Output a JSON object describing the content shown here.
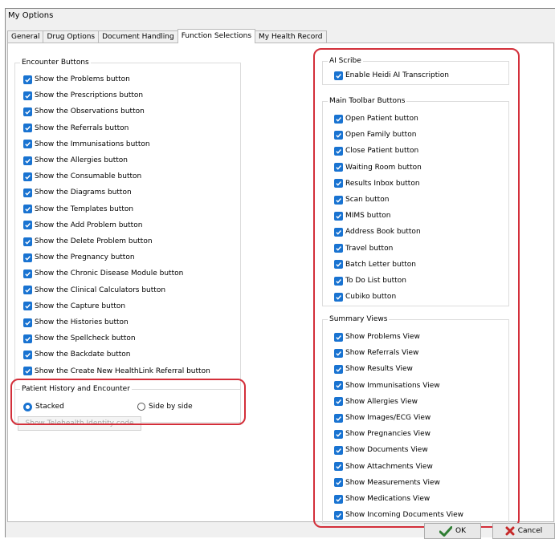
{
  "window": {
    "title": "My Options"
  },
  "tabs": [
    "General",
    "Drug Options",
    "Document Handling",
    "Function Selections",
    "My Health Record"
  ],
  "encounter": {
    "legend": "Encounter Buttons",
    "items": [
      "Show the Problems button",
      "Show the Prescriptions button",
      "Show the Observations button",
      "Show the Referrals button",
      "Show the Immunisations button",
      "Show the Allergies button",
      "Show the Consumable button",
      "Show the Diagrams button",
      "Show the Templates button",
      "Show the Add Problem button",
      "Show the Delete Problem button",
      "Show the Pregnancy button",
      "Show the Chronic Disease Module button",
      "Show the Clinical Calculators button",
      "Show the Capture button",
      "Show the Histories button",
      "Show the Spellcheck button",
      "Show the Backdate button",
      "Show the Create New HealthLink Referral button"
    ]
  },
  "history": {
    "legend": "Patient History and Encounter",
    "options": [
      "Stacked",
      "Side by side"
    ],
    "selected": "Stacked"
  },
  "telehealth_button": "Show Telehealth Identity code",
  "ai_scribe": {
    "legend": "AI Scribe",
    "items": [
      "Enable Heidi AI Transcription"
    ]
  },
  "toolbar": {
    "legend": "Main Toolbar Buttons",
    "items": [
      "Open Patient button",
      "Open Family button",
      "Close Patient button",
      "Waiting Room button",
      "Results Inbox button",
      "Scan button",
      "MIMS button",
      "Address Book button",
      "Travel button",
      "Batch Letter button",
      "To Do List button",
      "Cubiko button"
    ]
  },
  "summary": {
    "legend": "Summary Views",
    "items": [
      "Show Problems View",
      "Show Referrals View",
      "Show Results View",
      "Show Immunisations View",
      "Show Allergies View",
      "Show Images/ECG View",
      "Show Pregnancies View",
      "Show Documents View",
      "Show Attachments View",
      "Show Measurements View",
      "Show Medications View",
      "Show Incoming Documents View"
    ]
  },
  "footer": {
    "ok": "OK",
    "cancel": "Cancel"
  },
  "colors": {
    "checkbox": "#1973d1",
    "highlight": "#d32f3a",
    "ok_icon": "#2e7d32",
    "cancel_icon": "#c62828"
  }
}
